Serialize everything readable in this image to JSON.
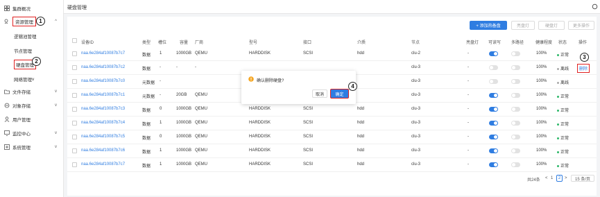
{
  "sidebar": {
    "items": [
      {
        "label": "集群概况",
        "icon": "dashboard-icon"
      },
      {
        "label": "资源管理",
        "icon": "resource-icon"
      },
      {
        "label": "逻辑池管理"
      },
      {
        "label": "节点管理"
      },
      {
        "label": "硬盘管理"
      },
      {
        "label": "网络管理"
      },
      {
        "label": "文件存储",
        "icon": "folder-icon"
      },
      {
        "label": "对象存储",
        "icon": "object-storage-icon"
      },
      {
        "label": "用户管理",
        "icon": "user-icon"
      },
      {
        "label": "监控中心",
        "icon": "monitor-icon"
      },
      {
        "label": "系统管理",
        "icon": "settings-icon"
      }
    ]
  },
  "header": {
    "title": "硬盘管理"
  },
  "toolbar": {
    "add_label": "+ 添加热备盘",
    "light_label": "亮盘灯",
    "health_label": "硬盘灯",
    "more_label": "更多操作"
  },
  "table": {
    "headers": [
      "设备ID",
      "类型",
      "槽位",
      "容量",
      "厂商",
      "型号",
      "接口",
      "介质",
      "节点",
      "亮盘灯",
      "可读写",
      "多路径",
      "健康程度",
      "状态",
      "操作"
    ],
    "rows": [
      {
        "id": "naa.6e284af10087b7c7",
        "type": "数据",
        "slot": "1",
        "cap": "1000GB",
        "vendor": "QEMU",
        "model": "HARDDISK",
        "iface": "SCSI",
        "media": "hdd",
        "node": "clu-2",
        "light": "-",
        "rw": true,
        "multi": false,
        "health": "100%",
        "status": "正常",
        "status_color": "green",
        "op": ""
      },
      {
        "id": "naa.6e284af10087b7c2",
        "type": "数据",
        "slot": "-",
        "cap": "-",
        "vendor": "-",
        "model": "",
        "iface": "",
        "media": "",
        "node": "clu-3",
        "light": "-",
        "rw": false,
        "multi": false,
        "health": "100%",
        "status": "离线",
        "status_color": "gray",
        "op": "删除"
      },
      {
        "id": "naa.6e284af10087b7c0",
        "type": "元数据",
        "slot": "-",
        "cap": "",
        "vendor": "",
        "model": "",
        "iface": "",
        "media": "",
        "node": "clu-3",
        "light": "-",
        "rw": false,
        "multi": false,
        "health": "100%",
        "status": "离线",
        "status_color": "gray",
        "op": ""
      },
      {
        "id": "naa.6e284af10087b7c1",
        "type": "元数据",
        "slot": "-",
        "cap": "20GB",
        "vendor": "QEMU",
        "model": "",
        "iface": "",
        "media": "",
        "node": "clu-3",
        "light": "-",
        "rw": true,
        "multi": false,
        "health": "100%",
        "status": "正常",
        "status_color": "green",
        "op": ""
      },
      {
        "id": "naa.6e284af10087b7c3",
        "type": "数据",
        "slot": "0",
        "cap": "1000GB",
        "vendor": "QEMU",
        "model": "HARDDISK",
        "iface": "SCSI",
        "media": "hdd",
        "node": "clu-3",
        "light": "-",
        "rw": true,
        "multi": false,
        "health": "100%",
        "status": "正常",
        "status_color": "green",
        "op": ""
      },
      {
        "id": "naa.6e284af10087b7c4",
        "type": "数据",
        "slot": "1",
        "cap": "1000GB",
        "vendor": "QEMU",
        "model": "HARDDISK",
        "iface": "SCSI",
        "media": "hdd",
        "node": "clu-3",
        "light": "-",
        "rw": true,
        "multi": false,
        "health": "100%",
        "status": "正常",
        "status_color": "green",
        "op": ""
      },
      {
        "id": "naa.6e284af10087b7c5",
        "type": "数据",
        "slot": "0",
        "cap": "1000GB",
        "vendor": "QEMU",
        "model": "HARDDISK",
        "iface": "SCSI",
        "media": "hdd",
        "node": "clu-3",
        "light": "-",
        "rw": true,
        "multi": false,
        "health": "100%",
        "status": "正常",
        "status_color": "green",
        "op": ""
      },
      {
        "id": "naa.6e284af10087b7c6",
        "type": "数据",
        "slot": "1",
        "cap": "1000GB",
        "vendor": "QEMU",
        "model": "HARDDISK",
        "iface": "SCSI",
        "media": "hdd",
        "node": "clu-3",
        "light": "-",
        "rw": true,
        "multi": false,
        "health": "100%",
        "status": "正常",
        "status_color": "green",
        "op": ""
      },
      {
        "id": "naa.6e284af10087b7c7",
        "type": "数据",
        "slot": "1",
        "cap": "1000GB",
        "vendor": "QEMU",
        "model": "HARDDISK",
        "iface": "SCSI",
        "media": "hdd",
        "node": "clu-3",
        "light": "-",
        "rw": true,
        "multi": false,
        "health": "100%",
        "status": "正常",
        "status_color": "green",
        "op": ""
      }
    ]
  },
  "popover": {
    "message": "确认删除硬盘?",
    "cancel": "取消",
    "confirm": "确定"
  },
  "pager": {
    "total": "共24条",
    "prev": "<",
    "page1": "1",
    "page2": "2",
    "next": ">",
    "size": "15 条/页"
  },
  "annotations": [
    "1",
    "2",
    "3",
    "4"
  ],
  "colors": {
    "accent": "#2f7de1",
    "annotation": "#e02020",
    "ok": "#2fb86a"
  }
}
